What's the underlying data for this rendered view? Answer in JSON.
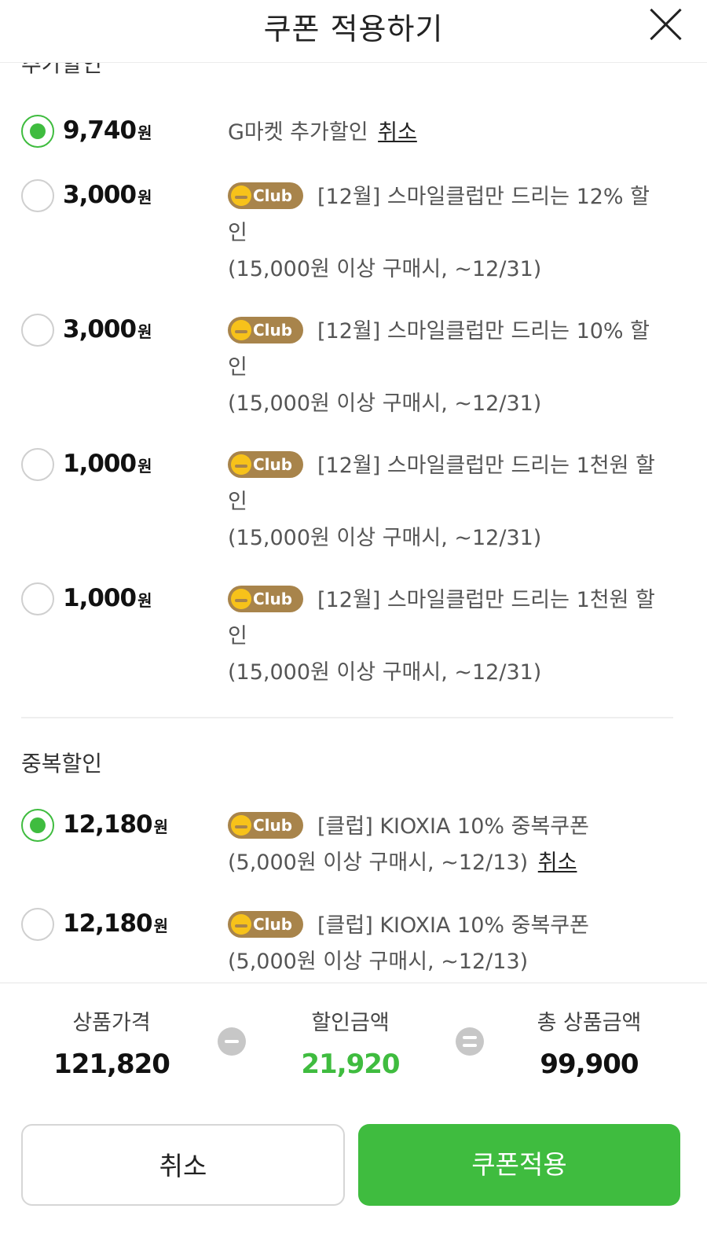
{
  "header": {
    "title": "쿠폰 적용하기"
  },
  "sections": {
    "extra_label": "추가할인",
    "dup_label": "중복할인"
  },
  "currency_unit": "원",
  "club_badge": "Club",
  "extra_coupons": [
    {
      "amount": "9,740",
      "selected": true,
      "line1": "G마켓 추가할인",
      "cancel": "취소"
    },
    {
      "amount": "3,000",
      "selected": false,
      "line1": "[12월] 스마일클럽만 드리는 12% 할",
      "line2": "인",
      "line3": "(15,000원 이상 구매시, ~12/31)"
    },
    {
      "amount": "3,000",
      "selected": false,
      "line1": "[12월] 스마일클럽만 드리는 10% 할",
      "line2": "인",
      "line3": "(15,000원 이상 구매시, ~12/31)"
    },
    {
      "amount": "1,000",
      "selected": false,
      "line1": "[12월] 스마일클럽만 드리는 1천원 할",
      "line2": "인",
      "line3": "(15,000원 이상 구매시, ~12/31)"
    },
    {
      "amount": "1,000",
      "selected": false,
      "line1": "[12월] 스마일클럽만 드리는 1천원 할",
      "line2": "인",
      "line3": "(15,000원 이상 구매시, ~12/31)"
    }
  ],
  "dup_coupons": [
    {
      "amount": "12,180",
      "selected": true,
      "line1": "[클럽] KIOXIA 10% 중복쿠폰",
      "line2": "(5,000원 이상 구매시, ~12/13)",
      "cancel": "취소"
    },
    {
      "amount": "12,180",
      "selected": false,
      "line1": "[클럽] KIOXIA 10% 중복쿠폰",
      "line2": "(5,000원 이상 구매시, ~12/13)"
    }
  ],
  "summary": {
    "price_label": "상품가격",
    "price_value": "121,820",
    "discount_label": "할인금액",
    "discount_value": "21,920",
    "total_label": "총 상품금액",
    "total_value": "99,900"
  },
  "buttons": {
    "cancel": "취소",
    "apply": "쿠폰적용"
  },
  "colors": {
    "accent": "#3fbc3f",
    "club": "#a8844b"
  }
}
